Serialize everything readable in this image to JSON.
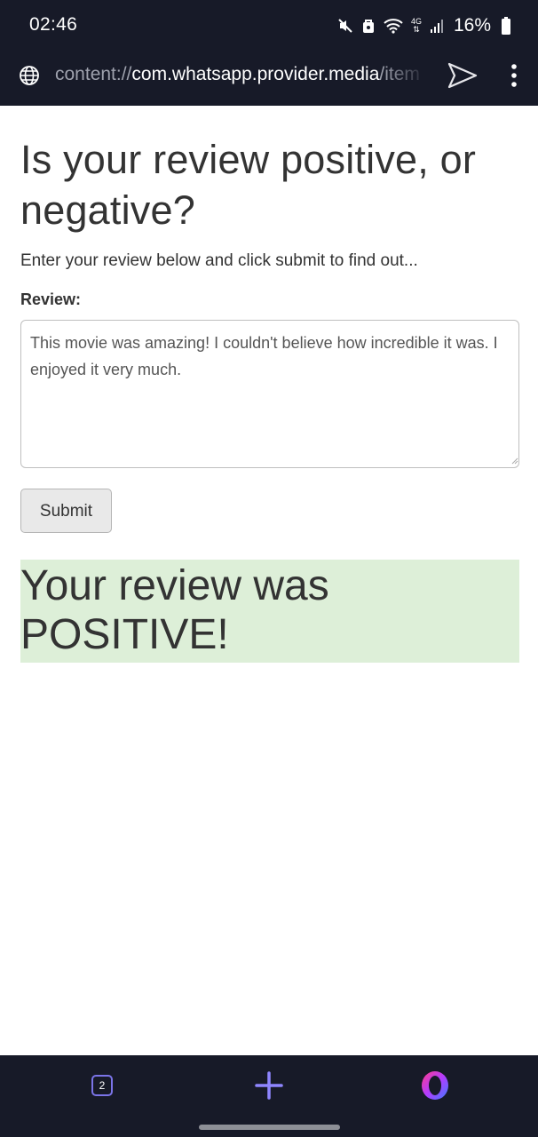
{
  "status_bar": {
    "time": "02:46",
    "network_type": "4G",
    "battery": "16%"
  },
  "address_bar": {
    "url_scheme": "content://",
    "url_host": "com.whatsapp.provider.media",
    "url_path": "/item"
  },
  "page": {
    "title": "Is your review positive, or negative?",
    "subtitle": "Enter your review below and click submit to find out...",
    "review_label": "Review:",
    "review_text": "This movie was amazing! I couldn't believe how incredible it was. I enjoyed it very much.",
    "submit_label": "Submit",
    "result_text": "Your review was POSITIVE!"
  },
  "bottom_nav": {
    "tab_count": "2"
  },
  "colors": {
    "browser_chrome": "#171a28",
    "result_background": "#ddefd8",
    "accent": "#7b74e8"
  }
}
